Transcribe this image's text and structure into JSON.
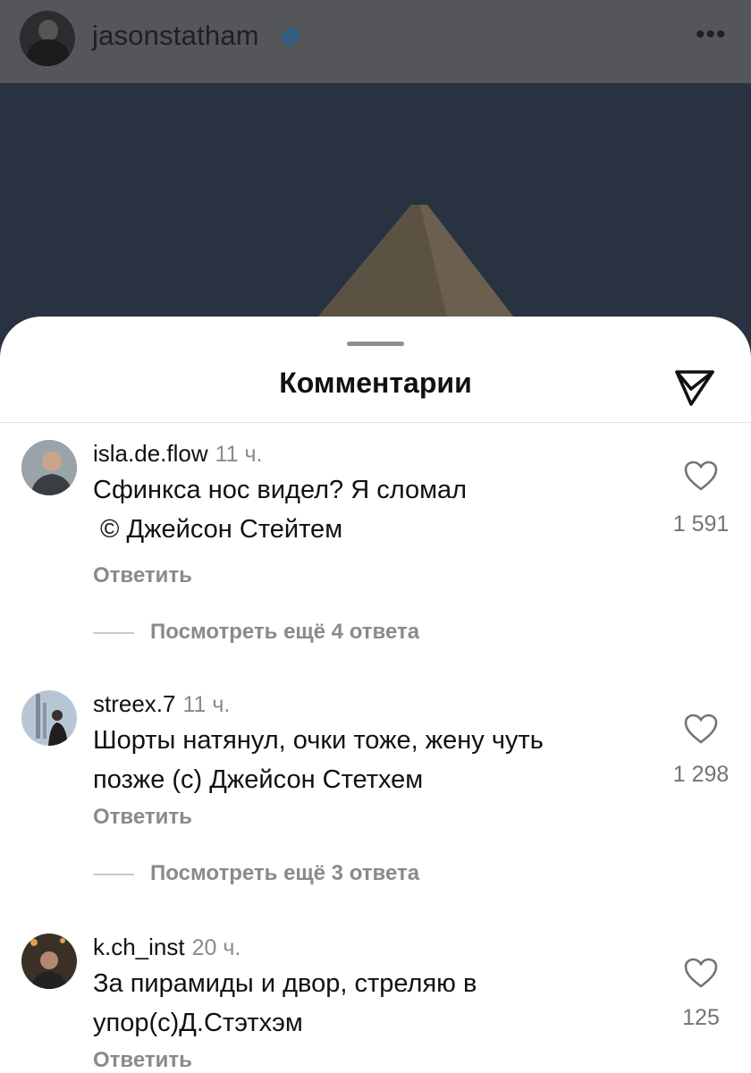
{
  "profile": {
    "username": "jasonstatham"
  },
  "sheet": {
    "title": "Комментарии"
  },
  "comments": [
    {
      "username": "isla.de.flow",
      "time": "11 ч.",
      "text_line1": "Сфинкса нос видел? Я сломал",
      "text_line2": " © Джейсон Стейтем",
      "likes": "1 591",
      "reply_label": "Ответить",
      "more_replies": "Посмотреть ещё 4 ответа"
    },
    {
      "username": "streex.7",
      "time": "11 ч.",
      "text_line1": "Шорты натянул, очки тоже, жену чуть",
      "text_line2": "позже (с) Джейсон Стетхем",
      "likes": "1 298",
      "reply_label": "Ответить",
      "more_replies": "Посмотреть ещё 3 ответа"
    },
    {
      "username": "k.ch_inst",
      "time": "20 ч.",
      "text_line1": "За пирамиды и двор, стреляю в",
      "text_line2": "упор(с)Д.Стэтхэм",
      "likes": "125",
      "reply_label": "Ответить"
    }
  ],
  "colors": {
    "verified": "#3897f0",
    "muted": "#8a8a8e",
    "overlay": "#545659"
  }
}
